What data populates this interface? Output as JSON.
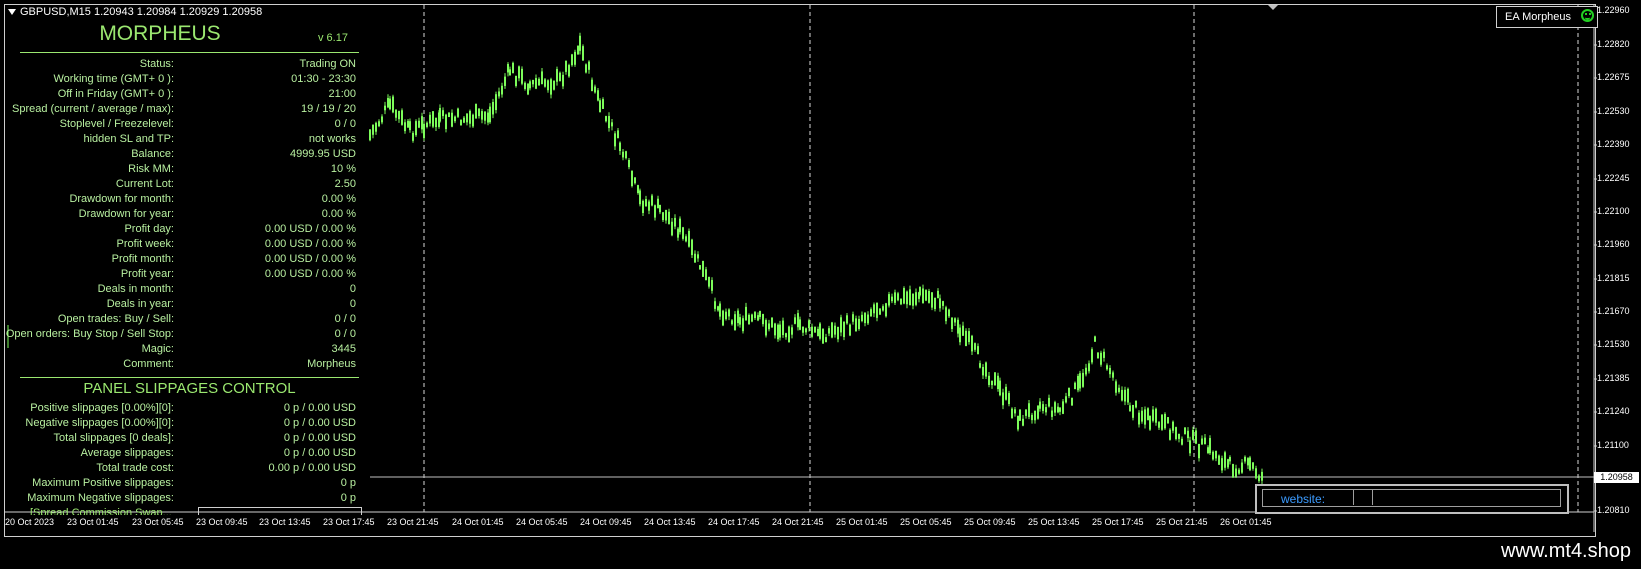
{
  "chart": {
    "symbol_title": "GBPUSD,M15  1.20943 1.20984 1.20929 1.20958",
    "ea_badge": "EA Morpheus",
    "current_price": "1.20958",
    "price_levels": [
      "1.22960",
      "1.22820",
      "1.22675",
      "1.22530",
      "1.22390",
      "1.22245",
      "1.22100",
      "1.21960",
      "1.21815",
      "1.21670",
      "1.21530",
      "1.21385",
      "1.21240",
      "1.21100",
      "1.20810"
    ],
    "time_labels": [
      "20 Oct 2023",
      "23 Oct 01:45",
      "23 Oct 05:45",
      "23 Oct 09:45",
      "23 Oct 13:45",
      "23 Oct 17:45",
      "23 Oct 21:45",
      "24 Oct 01:45",
      "24 Oct 05:45",
      "24 Oct 09:45",
      "24 Oct 13:45",
      "24 Oct 17:45",
      "24 Oct 21:45",
      "25 Oct 01:45",
      "25 Oct 05:45",
      "25 Oct 09:45",
      "25 Oct 13:45",
      "25 Oct 17:45",
      "25 Oct 21:45",
      "26 Oct 01:45"
    ],
    "colors": {
      "candle": "#7cfc5a",
      "background": "#000000",
      "text": "#ffffff",
      "panel_text": "#b8f0a0",
      "website": "#3b9bff"
    }
  },
  "panel": {
    "title": "MORPHEUS",
    "version": "v 6.17",
    "rows": [
      {
        "label": "Status:",
        "value": "Trading ON"
      },
      {
        "label": "Working time (GMT+ 0 ):",
        "value": "01:30 - 23:30"
      },
      {
        "label": "Off in Friday (GMT+ 0 ):",
        "value": "21:00"
      },
      {
        "label": "Spread (current / average / max):",
        "value": "19 / 19 / 20"
      },
      {
        "label": "Stoplevel  /  Freezelevel:",
        "value": "0  /  0"
      },
      {
        "label": "hidden SL and TP:",
        "value": "not works"
      },
      {
        "label": "Balance:",
        "value": "4999.95 USD"
      },
      {
        "label": "Risk MM:",
        "value": "10 %"
      },
      {
        "label": "Current Lot:",
        "value": "2.50"
      },
      {
        "label": "Drawdown for month:",
        "value": "0.00 %"
      },
      {
        "label": "Drawdown for year:",
        "value": "0.00 %"
      },
      {
        "label": "Profit day:",
        "value": "0.00 USD / 0.00 %"
      },
      {
        "label": "Profit week:",
        "value": "0.00 USD / 0.00 %"
      },
      {
        "label": "Profit month:",
        "value": "0.00 USD / 0.00 %"
      },
      {
        "label": "Profit year:",
        "value": "0.00 USD / 0.00 %"
      },
      {
        "label": "Deals in month:",
        "value": "0"
      },
      {
        "label": "Deals in year:",
        "value": "0"
      },
      {
        "label": "Open trades: Buy / Sell:",
        "value": "0  /  0"
      },
      {
        "label": "Open orders: Buy Stop / Sell Stop:",
        "value": "0  /  0"
      },
      {
        "label": "Magic:",
        "value": "3445"
      },
      {
        "label": "Comment:",
        "value": "Morpheus"
      }
    ],
    "slippage_title": "PANEL SLIPPAGES CONTROL",
    "slippage_rows": [
      {
        "label": "Positive slippages [0.00%][0]:",
        "value": "0 p / 0.00 USD"
      },
      {
        "label": "Negative slippages [0.00%][0]:",
        "value": "0 p / 0.00 USD"
      },
      {
        "label": "Total slippages [0 deals]:",
        "value": "0 p / 0.00 USD"
      },
      {
        "label": "Average slippages:",
        "value": "0 p / 0.00 USD"
      },
      {
        "label": "Total trade cost:",
        "value": "0.00 p / 0.00 USD"
      },
      {
        "label": "Maximum Positive slippages:",
        "value": "0 p"
      },
      {
        "label": "Maximum Negative slippages:",
        "value": "0 p"
      }
    ],
    "cut_off_text": "[Spread Commission Swap..."
  },
  "website_label": "website:",
  "watermark": "www.mt4.shop"
}
